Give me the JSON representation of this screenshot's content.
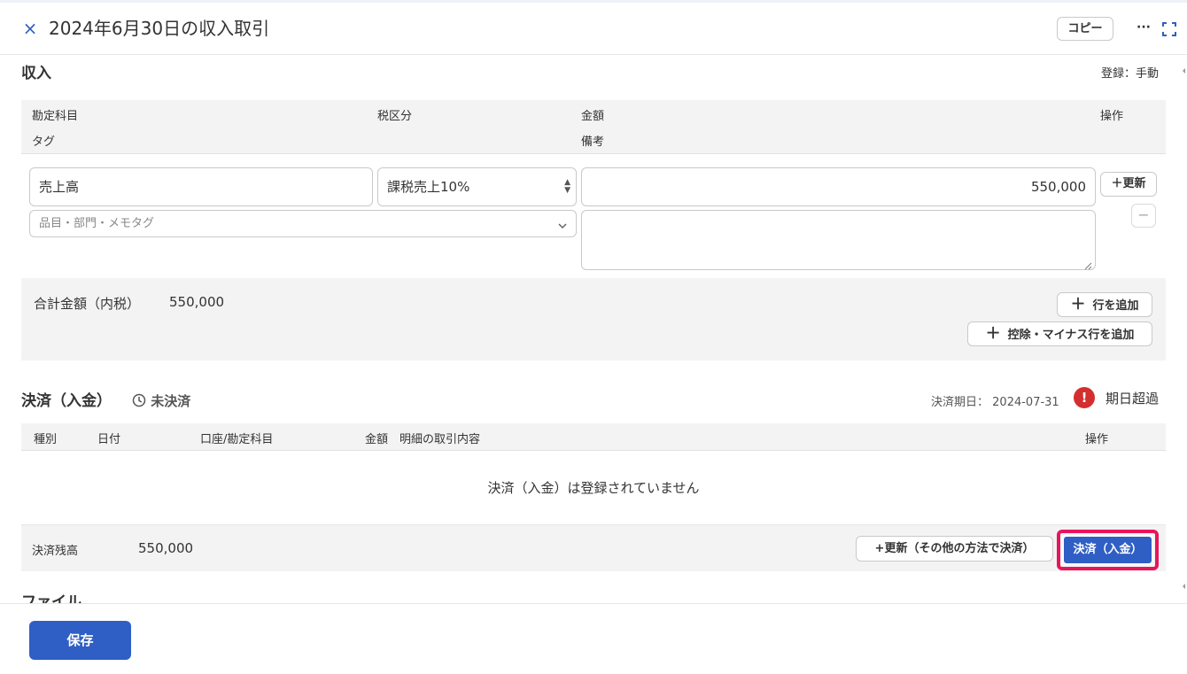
{
  "window": {
    "close_icon": "×",
    "title": "2024年6月30日の収入取引",
    "copy_label": "コピー",
    "more_icon": "···"
  },
  "income": {
    "section_title": "収入",
    "registration": "登録：手動",
    "headers": {
      "account": "勘定科目",
      "tax": "税区分",
      "amount": "金額",
      "action": "操作",
      "tag": "タグ",
      "memo": "備考"
    },
    "row": {
      "account_value": "売上高",
      "tax_value": "課税売上10%",
      "amount_value": "550,000",
      "tag_placeholder": "品目・部門・メモタグ",
      "memo_value": "",
      "update_label": "＋更新",
      "remove_label": "−"
    },
    "total_label": "合計金額（内税）",
    "total_value": "550,000",
    "add_row_label": "行を追加",
    "add_deduction_label": "控除・マイナス行を追加"
  },
  "settlement": {
    "section_title": "決済（入金）",
    "status": "未決済",
    "due_label": "決済期日：",
    "due_date": "2024-07-31",
    "overdue_label": "期日超過",
    "columns": [
      "種別",
      "日付",
      "口座/勘定科目",
      "金額",
      "明細の取引内容",
      "操作"
    ],
    "empty_message": "決済（入金）は登録されていません",
    "balance_label": "決済残高",
    "balance_value": "550,000",
    "other_method_label": "+更新（その他の方法で決済）",
    "pay_label": "決済（入金）"
  },
  "files": {
    "section_title": "ファイル"
  },
  "footer": {
    "save_label": "保存"
  },
  "colors": {
    "accent": "#2f5fc4",
    "highlight": "#e8145e",
    "alert": "#d32f2f"
  }
}
